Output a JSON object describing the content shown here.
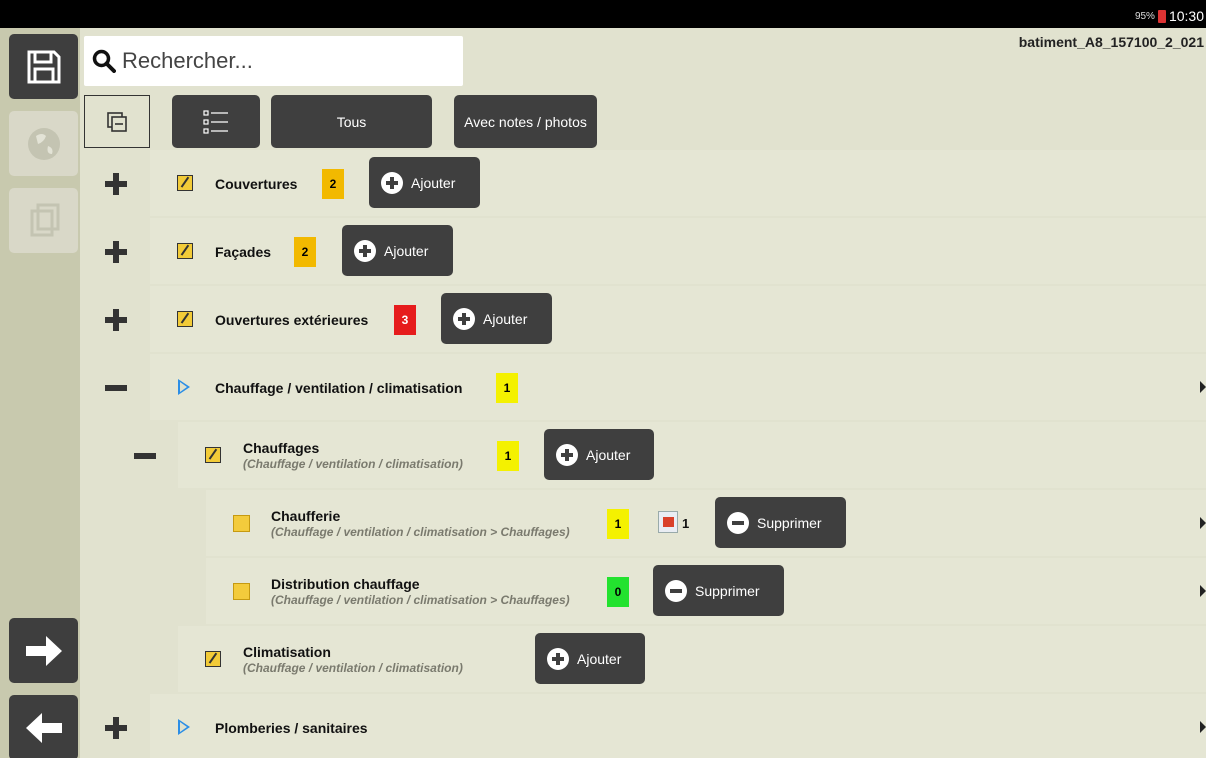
{
  "status_bar": {
    "battery": "95%",
    "time": "10:30"
  },
  "search": {
    "placeholder": "Rechercher..."
  },
  "file_name": "batiment_A8_157100_2_021",
  "toolbar": {
    "all_label": "Tous",
    "notes_label": "Avec notes / photos"
  },
  "tree": {
    "couvertures": {
      "label": "Couvertures",
      "count": "2",
      "add": "Ajouter"
    },
    "facades": {
      "label": "Façades",
      "count": "2",
      "add": "Ajouter"
    },
    "ouvertures": {
      "label": "Ouvertures extérieures",
      "count": "3",
      "add": "Ajouter"
    },
    "chauffage": {
      "label": "Chauffage / ventilation / climatisation",
      "count": "1"
    },
    "chauffages": {
      "label": "Chauffages",
      "path": "(Chauffage / ventilation / climatisation)",
      "count": "1",
      "add": "Ajouter"
    },
    "chaufferie": {
      "label": "Chaufferie",
      "path": "(Chauffage / ventilation / climatisation > Chauffages)",
      "count": "1",
      "photo_count": "1",
      "remove": "Supprimer"
    },
    "distribution": {
      "label": "Distribution chauffage",
      "path": "(Chauffage / ventilation / climatisation > Chauffages)",
      "count": "0",
      "remove": "Supprimer"
    },
    "climatisation": {
      "label": "Climatisation",
      "path": "(Chauffage / ventilation / climatisation)",
      "add": "Ajouter"
    },
    "plomberies": {
      "label": "Plomberies / sanitaires"
    }
  },
  "colors": {
    "badge_orange": "#f2b900",
    "badge_red": "#e61c1c",
    "badge_yellow": "#f4f100",
    "badge_green": "#23e22f",
    "button_dark": "#3f3f3f",
    "background": "#e1e2cf"
  }
}
